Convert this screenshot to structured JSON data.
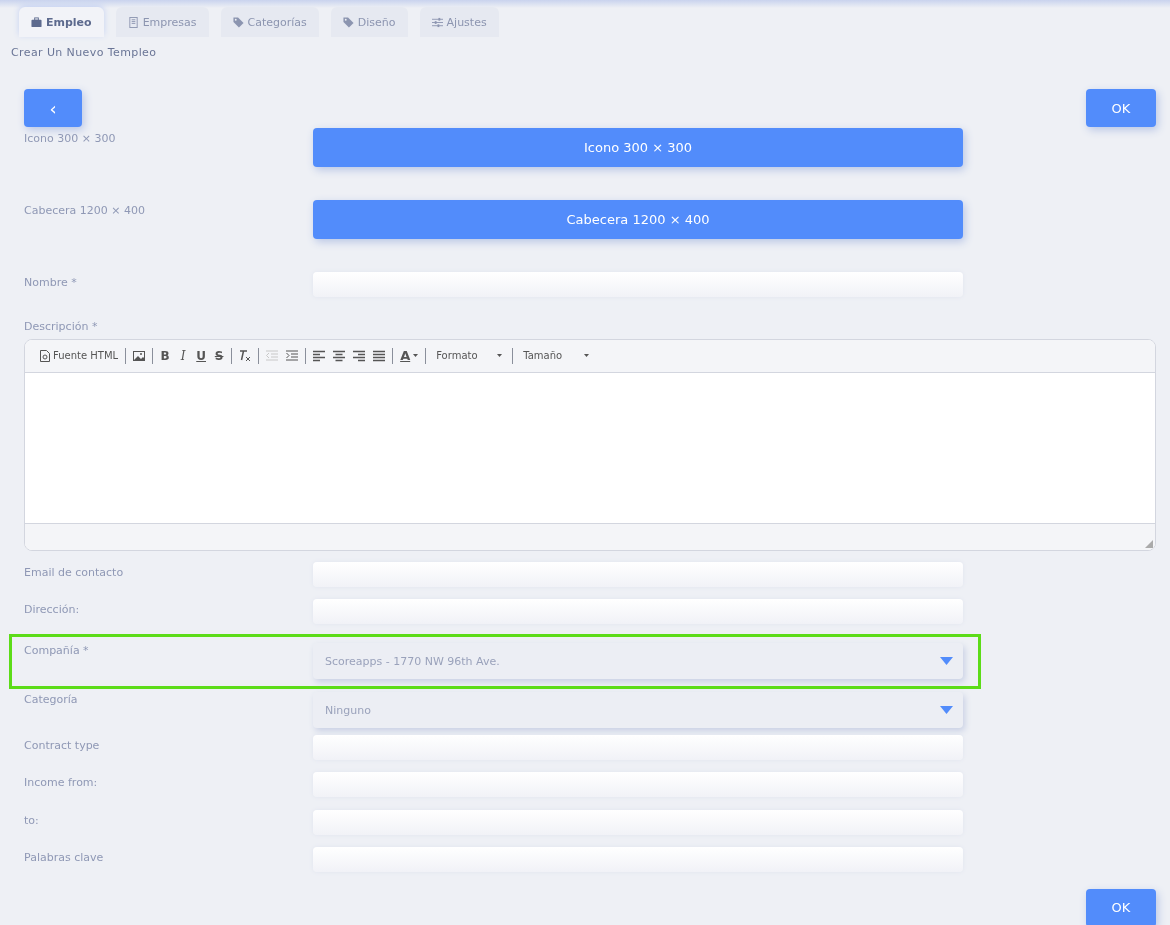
{
  "tabs": [
    {
      "label": "Empleo",
      "selected": true
    },
    {
      "label": "Empresas",
      "selected": false
    },
    {
      "label": "Categorías",
      "selected": false
    },
    {
      "label": "Diseño",
      "selected": false
    },
    {
      "label": "Ajustes",
      "selected": false
    }
  ],
  "page_title": "Crear Un Nuevo Templeo",
  "back_button": "‹",
  "ok_button_top": "OK",
  "fields": [
    {
      "kind": "upload",
      "label": "Icono 300 × 300",
      "button": "Icono 300 × 300"
    },
    {
      "kind": "upload",
      "label": "Cabecera 1200 × 400",
      "button": "Cabecera 1200 × 400"
    },
    {
      "kind": "text",
      "label": "Nombre *"
    },
    {
      "kind": "editor",
      "label": "Descripción *"
    },
    {
      "kind": "text",
      "label": "Email de contacto"
    },
    {
      "kind": "text",
      "label": "Dirección:"
    },
    {
      "kind": "select",
      "label": "Compañía *",
      "value": "Scoreapps - 1770 NW 96th Ave.",
      "highlighted": true
    },
    {
      "kind": "select",
      "label": "Categoría",
      "value": "Ninguno",
      "highlighted": false
    },
    {
      "kind": "text",
      "label": "Contract type"
    },
    {
      "kind": "text",
      "label": "Income from:"
    },
    {
      "kind": "text",
      "label": "to:"
    },
    {
      "kind": "text",
      "label": "Palabras clave"
    }
  ],
  "editor_toolbar": [
    [
      {
        "kind": "source",
        "label": "Fuente HTML",
        "disabled": false
      }
    ],
    [
      {
        "kind": "image",
        "disabled": false
      }
    ],
    [
      {
        "kind": "bold",
        "label": "B",
        "disabled": false
      },
      {
        "kind": "italic",
        "label": "I",
        "disabled": false
      },
      {
        "kind": "underline",
        "label": "U",
        "disabled": false
      },
      {
        "kind": "strike",
        "label": "S",
        "disabled": false
      }
    ],
    [
      {
        "kind": "clear",
        "disabled": false
      }
    ],
    [
      {
        "kind": "outdent",
        "disabled": true
      },
      {
        "kind": "indent",
        "disabled": false
      }
    ],
    [
      {
        "kind": "align-left",
        "disabled": false
      },
      {
        "kind": "align-center",
        "disabled": false
      },
      {
        "kind": "align-right",
        "disabled": false
      },
      {
        "kind": "justify",
        "disabled": false
      }
    ],
    [
      {
        "kind": "color",
        "label": "A",
        "disabled": false
      }
    ],
    [
      {
        "kind": "dropdown",
        "label": "Formato",
        "disabled": false
      }
    ],
    [
      {
        "kind": "dropdown",
        "label": "Tamaño",
        "disabled": false
      }
    ]
  ],
  "ok_button_bottom": "OK"
}
